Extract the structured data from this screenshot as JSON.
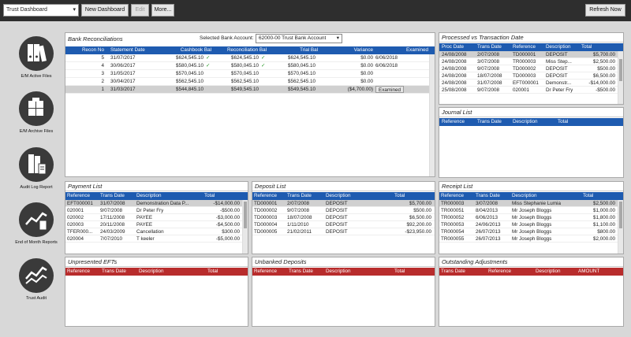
{
  "toolbar": {
    "dashboard_select": "Trust Dashboard",
    "new_dashboard": "New Dashboard",
    "edit": "Edit",
    "more": "More...",
    "refresh": "Refresh Now"
  },
  "sidebar": [
    {
      "label": "E/M Active Files",
      "icon": "binders-icon"
    },
    {
      "label": "E/M Archive Files",
      "icon": "archive-boxes-icon"
    },
    {
      "label": "Audit Log Report",
      "icon": "audit-log-icon"
    },
    {
      "label": "End of Month Reports",
      "icon": "trend-chart-icon"
    },
    {
      "label": "Trust Audit",
      "icon": "trust-audit-icon"
    }
  ],
  "bank_reconciliations": {
    "title": "Bank Reconciliations",
    "selected_label": "Selected Bank Account:",
    "selected_value": "62000-00  Trust Bank Account",
    "columns": [
      "Recon No",
      "Statement Date",
      "Cashbook Bal",
      "Reconciliation Bal",
      "Trial Bal",
      "Variance",
      "Examined"
    ],
    "rows": [
      {
        "no": "5",
        "date": "31/07/2017",
        "cash": "$624,545.10",
        "cash_ok": "✓",
        "recon": "$624,545.10",
        "recon_ok": "✓",
        "trial": "$624,545.10",
        "var": "$0.00",
        "exam": "6/06/2018"
      },
      {
        "no": "4",
        "date": "30/06/2017",
        "cash": "$580,045.10",
        "cash_ok": "✓",
        "recon": "$580,045.10",
        "recon_ok": "✓",
        "trial": "$580,045.10",
        "var": "$0.00",
        "exam": "6/06/2018"
      },
      {
        "no": "3",
        "date": "31/05/2017",
        "cash": "$570,045.10",
        "cash_ok": "",
        "recon": "$570,045.10",
        "recon_ok": "",
        "trial": "$570,045.10",
        "var": "$0.00",
        "exam": ""
      },
      {
        "no": "2",
        "date": "30/04/2017",
        "cash": "$562,545.10",
        "cash_ok": "",
        "recon": "$562,545.10",
        "recon_ok": "",
        "trial": "$562,545.10",
        "var": "$0.00",
        "exam": ""
      },
      {
        "no": "1",
        "date": "31/03/2017",
        "cash": "$544,845.10",
        "cash_ok": "",
        "recon": "$549,545.10",
        "recon_ok": "",
        "trial": "$549,545.10",
        "var": "($4,700.00)",
        "exam": "Examined"
      }
    ]
  },
  "processed": {
    "title": "Processed vs Transaction Date",
    "columns": [
      "Proc Date",
      "Trans Date",
      "Reference",
      "Description",
      "Total"
    ],
    "rows": [
      [
        "24/08/2008",
        "2/07/2008",
        "TD000001",
        "DEPOSIT",
        "$5,700.00"
      ],
      [
        "24/08/2008",
        "3/07/2008",
        "TR000003",
        "Miss Step...",
        "$2,500.00"
      ],
      [
        "24/08/2008",
        "9/07/2008",
        "TD000002",
        "DEPOSIT",
        "$500.00"
      ],
      [
        "24/08/2008",
        "18/07/2008",
        "TD000003",
        "DEPOSIT",
        "$6,500.00"
      ],
      [
        "24/08/2008",
        "31/07/2008",
        "EFT000001",
        "Demonstr...",
        "-$14,000.00"
      ],
      [
        "25/08/2008",
        "9/07/2008",
        "020001",
        "Dr Peter Fry",
        "-$500.00"
      ]
    ]
  },
  "journal": {
    "title": "Journal List",
    "columns": [
      "Reference",
      "Trans Date",
      "Description",
      "Total"
    ]
  },
  "payment": {
    "title": "Payment List",
    "columns": [
      "Reference",
      "Trans Date",
      "Description",
      "Total"
    ],
    "rows": [
      [
        "EFT000001",
        "31/07/2008",
        "Demonstration Data P...",
        "-$14,000.00"
      ],
      [
        "020001",
        "9/07/2008",
        "Dr Peter Fry",
        "-$500.00"
      ],
      [
        "020002",
        "17/11/2008",
        "PAYEE",
        "-$3,000.00"
      ],
      [
        "020003",
        "20/11/2008",
        "PAYEE",
        "-$4,500.00"
      ],
      [
        "TFER000...",
        "24/03/2009",
        "Cancellation",
        "$300.00"
      ],
      [
        "020004",
        "7/07/2010",
        "T keeler",
        "-$5,000.00"
      ]
    ]
  },
  "deposit": {
    "title": "Deposit List",
    "columns": [
      "Reference",
      "Trans Date",
      "Description",
      "Total"
    ],
    "rows": [
      [
        "TD000001",
        "2/07/2008",
        "DEPOSIT",
        "$5,700.00"
      ],
      [
        "TD000002",
        "9/07/2008",
        "DEPOSIT",
        "$500.00"
      ],
      [
        "TD000003",
        "18/07/2008",
        "DEPOSIT",
        "$6,500.00"
      ],
      [
        "TD000004",
        "1/11/2010",
        "DEPOSIT",
        "$92,200.00"
      ],
      [
        "TD000005",
        "21/02/2011",
        "DEPOSIT",
        "-$23,950.00"
      ]
    ]
  },
  "receipt": {
    "title": "Receipt List",
    "columns": [
      "Reference",
      "Trans Date",
      "Description",
      "Total"
    ],
    "rows": [
      [
        "TR000003",
        "3/07/2008",
        "Miss Stephanie Lumia",
        "$2,500.00"
      ],
      [
        "TR000051",
        "8/04/2013",
        "Mr Joseph Bloggs",
        "$1,000.00"
      ],
      [
        "TR000052",
        "6/06/2013",
        "Mr Joseph Bloggs",
        "$1,800.00"
      ],
      [
        "TR000053",
        "24/06/2013",
        "Mr Joseph Bloggs",
        "$1,100.00"
      ],
      [
        "TR000054",
        "26/07/2013",
        "Mr Joseph Bloggs",
        "$800.00"
      ],
      [
        "TR000055",
        "26/07/2013",
        "Mr Joseph Bloggs",
        "$2,000.00"
      ]
    ]
  },
  "unpresented": {
    "title": "Unpresented EFTs",
    "columns": [
      "Reference",
      "Trans Date",
      "Description",
      "Total"
    ]
  },
  "unbanked": {
    "title": "Unbanked Deposits",
    "columns": [
      "Reference",
      "Trans Date",
      "Description",
      "Total"
    ]
  },
  "outstanding": {
    "title": "Outstanding Adjustments",
    "columns": [
      "Trans Date",
      "Reference",
      "Description",
      "AMOUNT"
    ]
  },
  "colors": {
    "header_blue": "#1e5bb0",
    "header_red": "#b82c2c",
    "selected_row": "#d0d0d0"
  }
}
